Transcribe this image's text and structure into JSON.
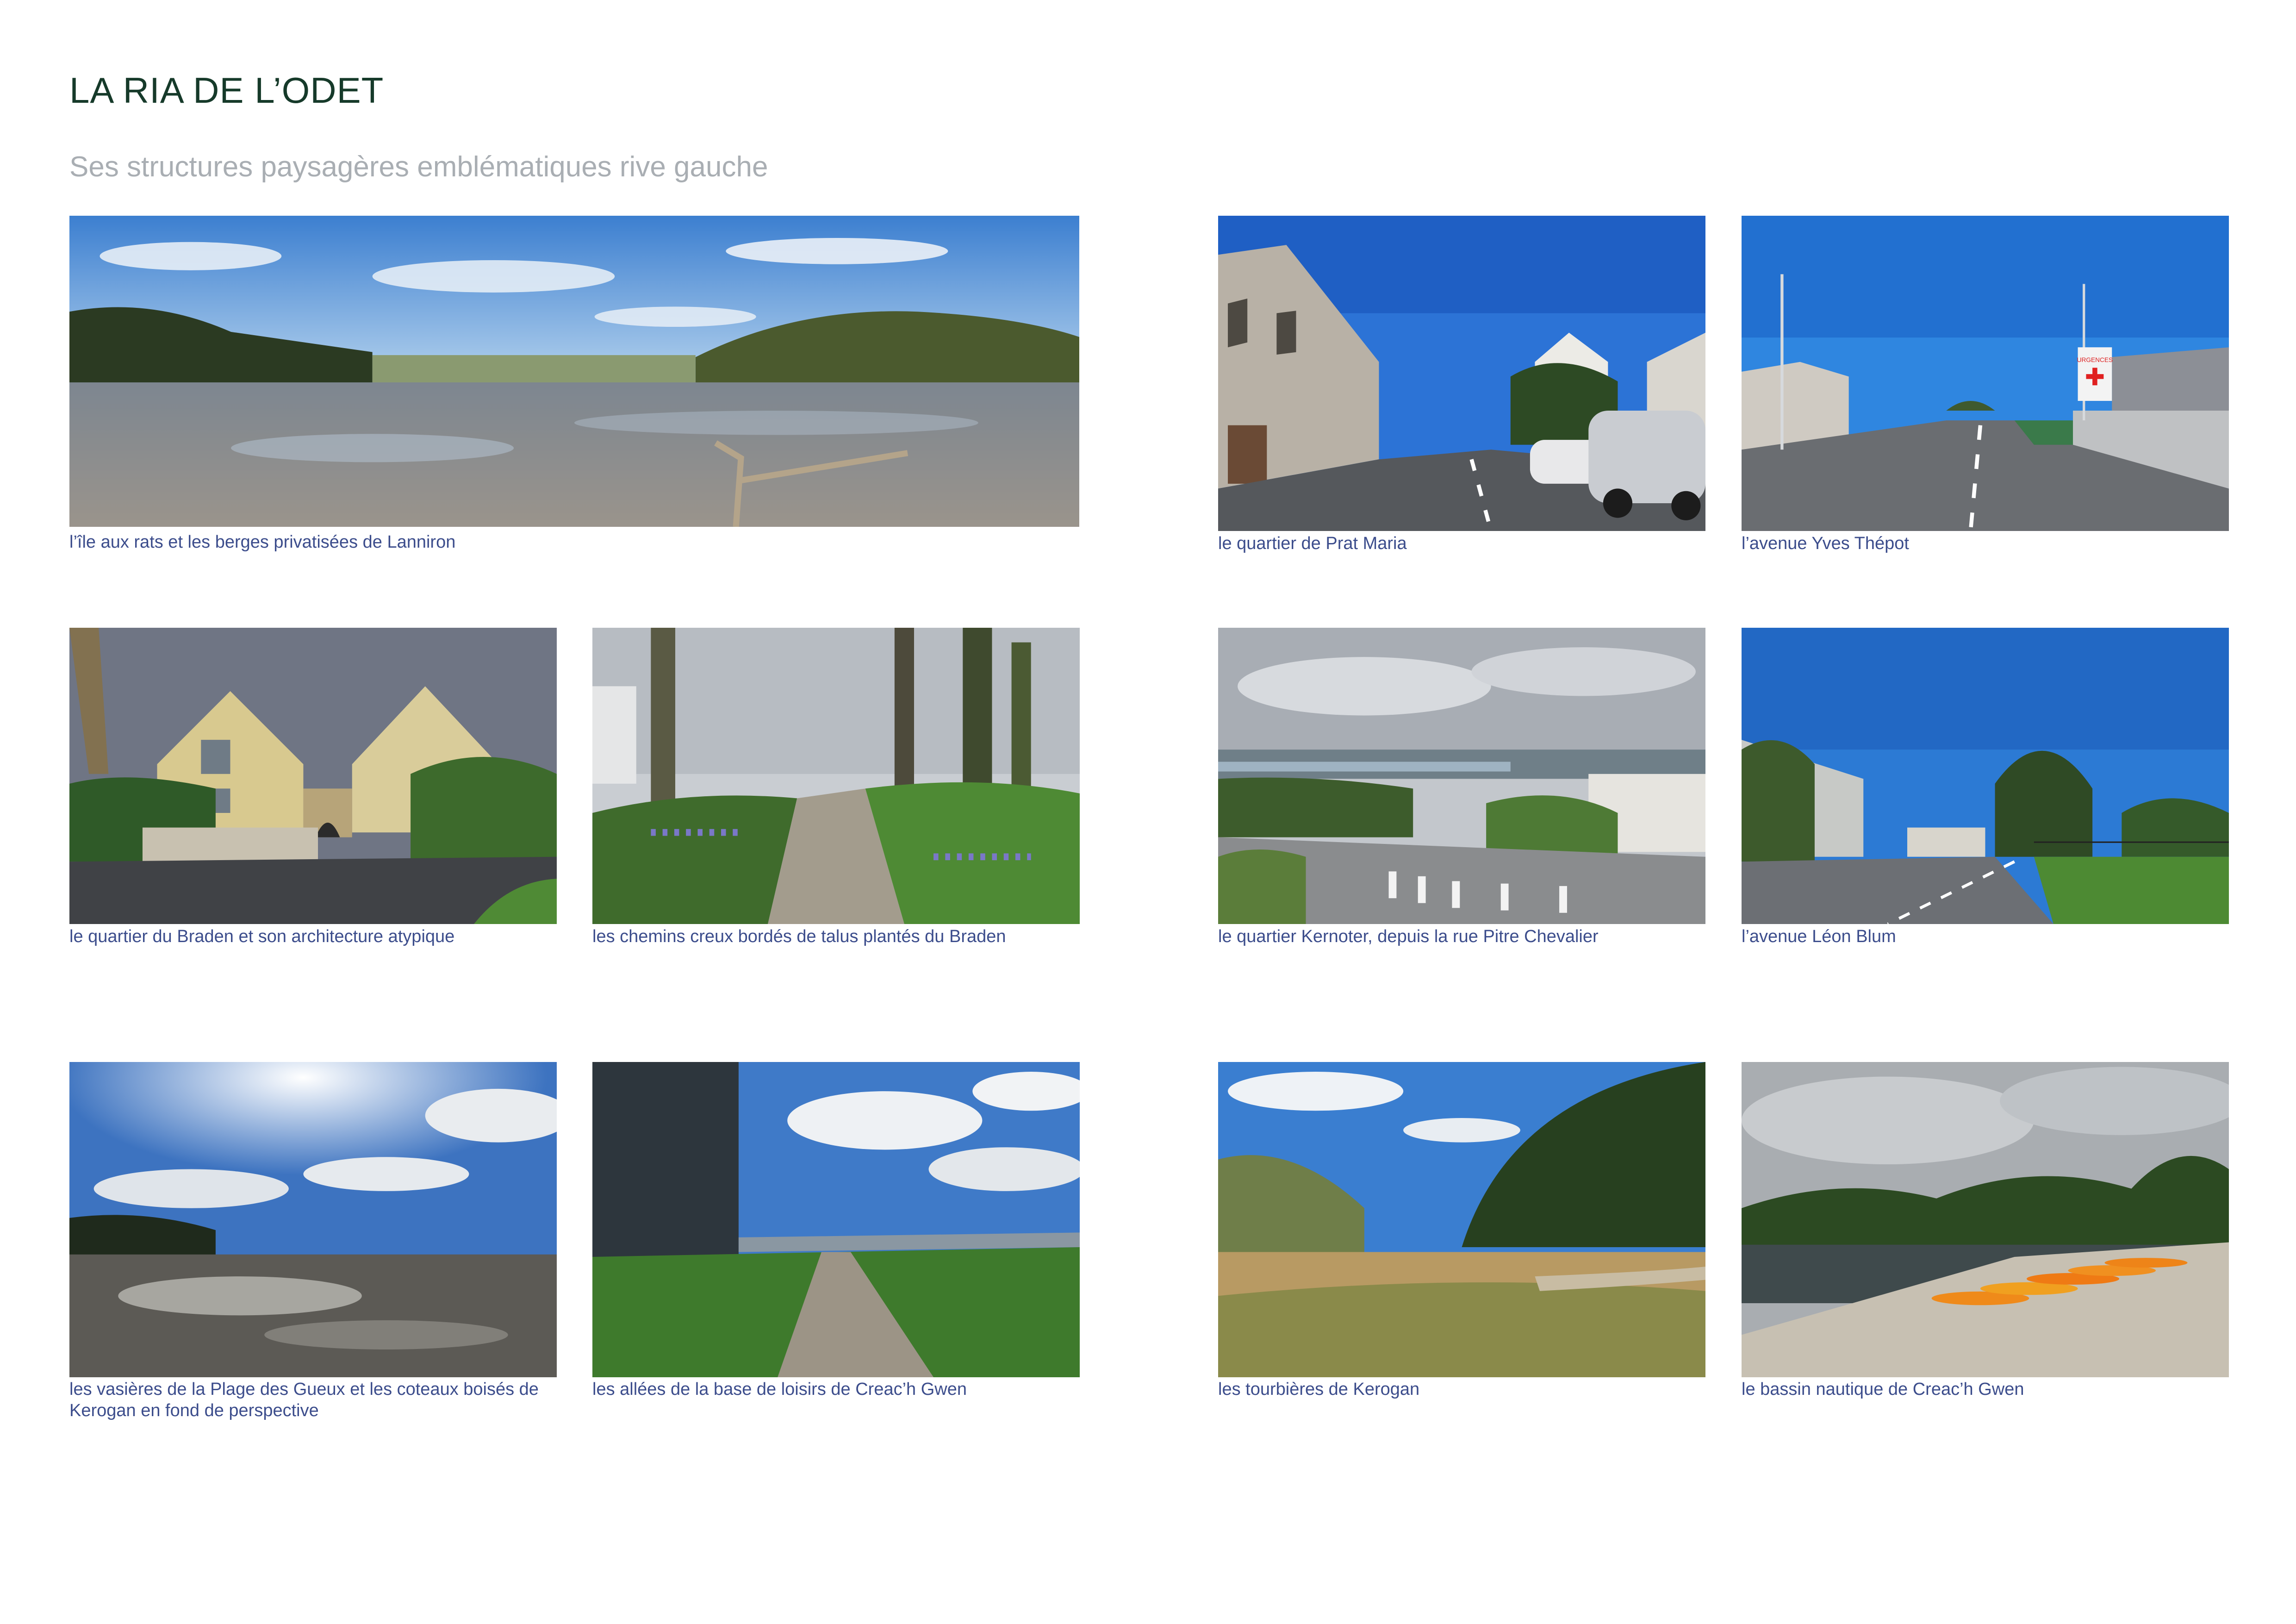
{
  "page": {
    "title": "LA RIA DE L’ODET",
    "subtitle": "Ses structures paysagères emblématiques rive gauche"
  },
  "photos": [
    {
      "id": "lanniron",
      "caption": "l’île aux rats et les berges privatisées de Lanniron"
    },
    {
      "id": "prat-maria",
      "caption": "le quartier de Prat Maria"
    },
    {
      "id": "yves-thepot",
      "caption": "l’avenue Yves Thépot"
    },
    {
      "id": "braden-architecture",
      "caption": "le quartier du Braden et son architecture atypique"
    },
    {
      "id": "chemins-creux",
      "caption": "les chemins creux bordés de talus plantés du Braden"
    },
    {
      "id": "kernoter",
      "caption": "le quartier Kernoter, depuis la rue Pitre Chevalier"
    },
    {
      "id": "leon-blum",
      "caption": "l’avenue Léon Blum"
    },
    {
      "id": "vasieres",
      "caption": "les vasières de la Plage des Gueux et les coteaux boisés de Kerogan en fond de perspective"
    },
    {
      "id": "allees-creach-gwen",
      "caption": "les allées de la base de loisirs de Creac’h Gwen"
    },
    {
      "id": "tourbieres",
      "caption": "les tourbières de Kerogan"
    },
    {
      "id": "bassin-nautique",
      "caption": "le bassin nautique de Creac’h Gwen"
    }
  ],
  "photo_signs": {
    "urgences": "URGENCES"
  },
  "colors": {
    "title": "#163a2a",
    "subtitle": "#a9aeb3",
    "caption": "#3c4d8c"
  }
}
